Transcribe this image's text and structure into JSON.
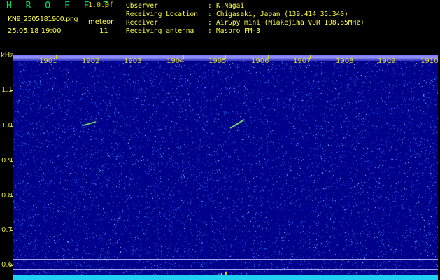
{
  "header": {
    "app_title": "H R O F F T",
    "version": "1.0.0f",
    "file_name": "KN9_2505181900.png",
    "meteor_label": "meteor",
    "date_time": "25.05.18 19:00",
    "meteor_count": "11"
  },
  "info": [
    {
      "label": "Observer",
      "value": "K.Nagai"
    },
    {
      "label": "Receiving Location",
      "value": "Chigasaki, Japan (139.414 35.340)"
    },
    {
      "label": "Receiver",
      "value": "AirSpy mini (Miakejima VOR 108.65MHz)"
    },
    {
      "label": "Receiving antenna",
      "value": "Maspro FM-3"
    }
  ],
  "spectrogram": {
    "y_unit": "kHz",
    "y_ticks": [
      "1.1",
      "1.0",
      "0.9",
      "0.8",
      "0.7",
      "0.6"
    ],
    "x_ticks": [
      "1901",
      "1902",
      "1903",
      "1904",
      "1905",
      "1906",
      "1907",
      "1908",
      "1909",
      "1910"
    ],
    "colors": {
      "background": "#00008a",
      "noise": "#4aa0ff",
      "band": "#20d0f0",
      "meteor": "#a0ff60"
    }
  }
}
